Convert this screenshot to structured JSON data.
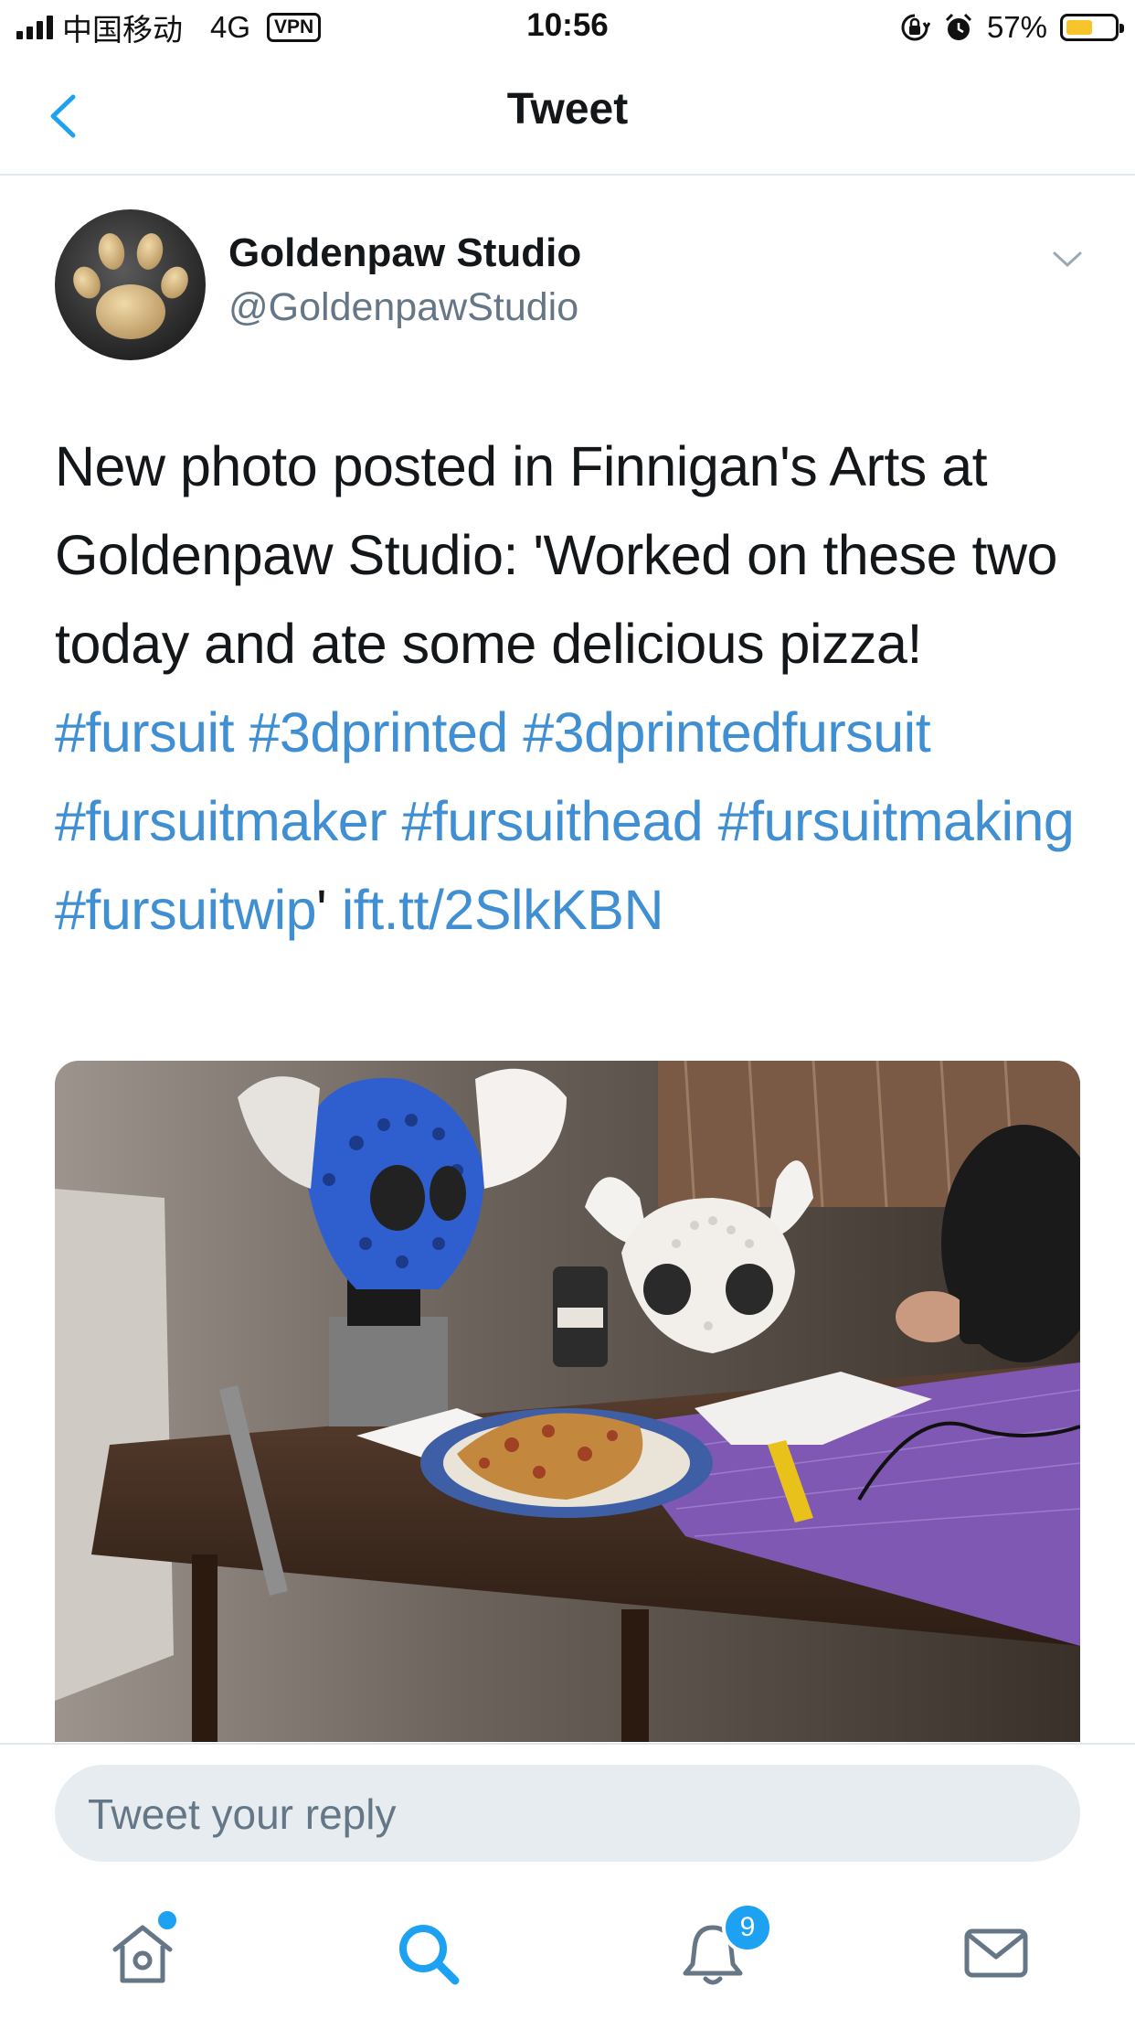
{
  "status_bar": {
    "carrier": "中国移动",
    "network": "4G",
    "vpn": "VPN",
    "time": "10:56",
    "battery_percent": "57%",
    "battery_level": 0.57
  },
  "nav": {
    "title": "Tweet"
  },
  "tweet": {
    "author_name": "Goldenpaw Studio",
    "author_handle": "@GoldenpawStudio",
    "text_intro": "New photo posted in Finnigan's Arts at Goldenpaw Studio: 'Worked on these two today and ate some delicious pizza! ",
    "hashtags": [
      "#fursuit",
      "#3dprinted",
      "#3dprintedfursuit",
      "#fursuitmaker",
      "#fursuithead",
      "#fursuitmaking",
      "#fursuitwip"
    ],
    "quote_close": "'",
    "link": "ift.tt/2SlkKBN"
  },
  "reply": {
    "placeholder": "Tweet your reply"
  },
  "tabbar": {
    "notifications_badge": "9"
  },
  "colors": {
    "accent": "#1da1f2",
    "link": "#3f8fd2",
    "muted": "#657786",
    "battery": "#f6c42b"
  }
}
